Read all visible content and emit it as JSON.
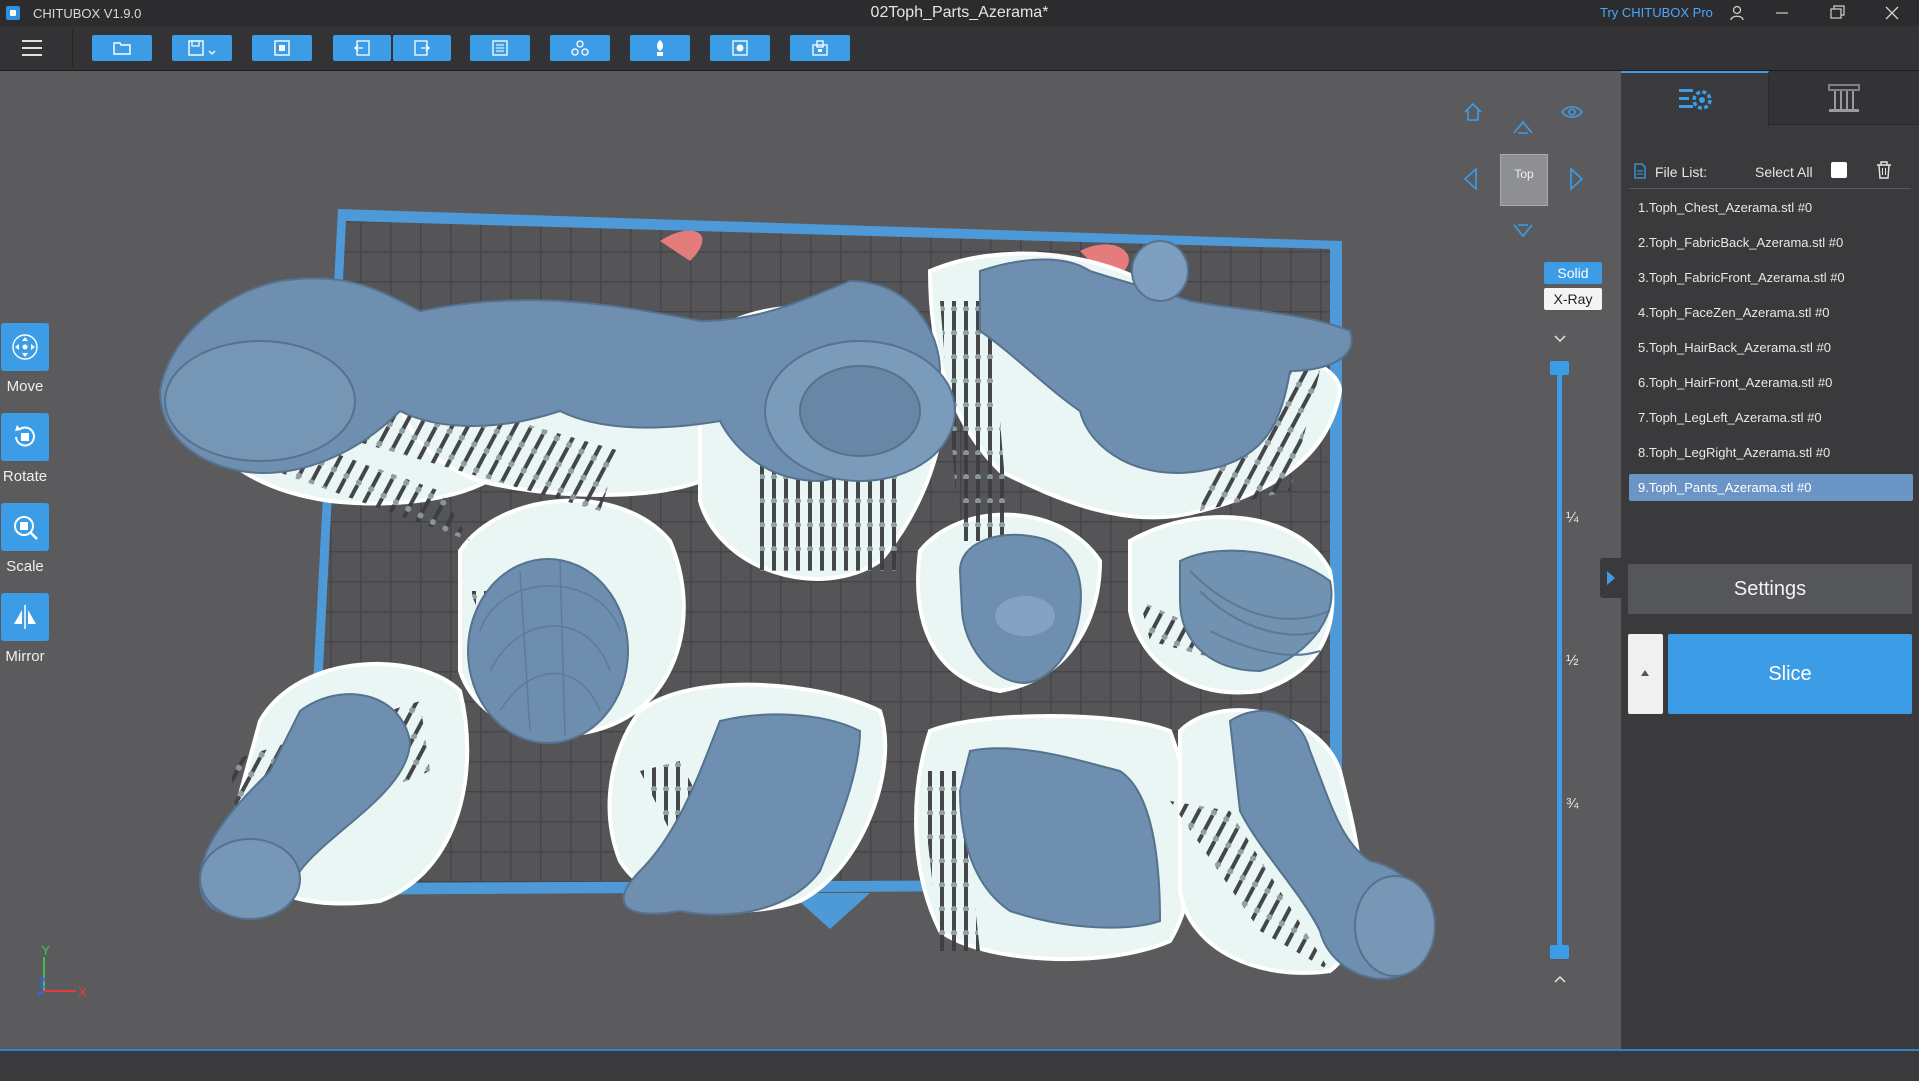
{
  "app": {
    "name": "CHITUBOX V1.9.0",
    "document_title": "02Toph_Parts_Azerama*",
    "try_pro": "Try CHITUBOX Pro"
  },
  "toolbar": {
    "icons": [
      "open-file-icon",
      "save-icon",
      "import-icon",
      "undo-icon",
      "redo-icon",
      "layout-icon",
      "duplicate-icon",
      "support-icon",
      "hollow-icon",
      "dig-hole-icon"
    ]
  },
  "tools": {
    "move": "Move",
    "rotate": "Rotate",
    "scale": "Scale",
    "mirror": "Mirror"
  },
  "view": {
    "top_label": "Top",
    "solid": "Solid",
    "xray": "X-Ray"
  },
  "slider": {
    "marks": [
      "¼",
      "½",
      "¾"
    ]
  },
  "axis": {
    "y": "Y",
    "z": "Z",
    "x": "X"
  },
  "file_panel": {
    "title": "File List:",
    "select_all": "Select All",
    "files": [
      "1.Toph_Chest_Azerama.stl #0",
      "2.Toph_FabricBack_Azerama.stl #0",
      "3.Toph_FabricFront_Azerama.stl #0",
      "4.Toph_FaceZen_Azerama.stl #0",
      "5.Toph_HairBack_Azerama.stl #0",
      "6.Toph_HairFront_Azerama.stl #0",
      "7.Toph_LegLeft_Azerama.stl #0",
      "8.Toph_LegRight_Azerama.stl #0",
      "9.Toph_Pants_Azerama.stl #0"
    ],
    "active_index": 8
  },
  "actions": {
    "settings": "Settings",
    "slice": "Slice"
  },
  "colors": {
    "accent": "#3c9de6",
    "model": "#6f8fb0",
    "raft": "#dcf1ef"
  }
}
